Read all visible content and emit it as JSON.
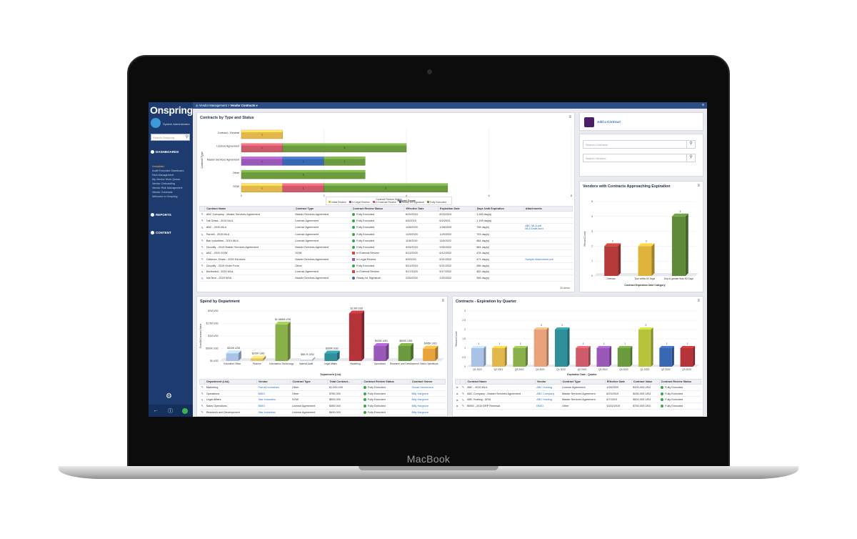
{
  "device": {
    "brand": "MacBook"
  },
  "app": {
    "logo": "Onspring",
    "user": "System Administrator",
    "search_placeholder": "Search Onspring",
    "sections": {
      "dashboards": "DASHBOARDS",
      "reports": "REPORTS",
      "content": "CONTENT"
    },
    "dashboards": [
      "Unbuilded",
      "Audit Executive Dashboard",
      "R&A Management",
      "My Vendor Work Queue",
      "Vendor Onboarding",
      "Vendor Risk Management",
      "Vendor Contracts",
      "Welcome to Onspring"
    ],
    "active_dashboard": 0
  },
  "breadcrumb": {
    "root": "Vendor Management",
    "sep": ">",
    "current": "Vendor Contracts ▾"
  },
  "contracts_panel": {
    "title": "Contracts by Type and Status",
    "legend_title": "Contract Review Status",
    "chart_data": {
      "type": "bar",
      "orientation": "horizontal",
      "stacked": true,
      "categories": [
        "Contract - General",
        "License Agreement",
        "Master Services Agreement",
        "Other",
        "SOW"
      ],
      "series": [
        {
          "name": "Initial Review",
          "color": "#e3b84a",
          "values": [
            1,
            0,
            0,
            0,
            1
          ]
        },
        {
          "name": "In Legal Review",
          "color": "#9a58b8",
          "values": [
            0,
            0,
            1,
            0,
            0
          ]
        },
        {
          "name": "In External Review",
          "color": "#cf5a6a",
          "values": [
            0,
            1,
            0,
            0,
            1
          ]
        },
        {
          "name": "Ready for Signature",
          "color": "#3a67b2",
          "values": [
            0,
            0,
            1,
            0,
            0
          ]
        },
        {
          "name": "Fully Executed",
          "color": "#6c9a3e",
          "values": [
            0,
            3,
            1,
            3,
            3
          ]
        }
      ],
      "xlabel": "Record Count",
      "ylabel": "Contract Type",
      "xlim": [
        0,
        8
      ],
      "ticks": [
        0,
        2,
        4,
        6,
        8
      ]
    },
    "table": {
      "headers": [
        "Contract Name",
        "Contract Type",
        "Contract Review Status",
        "Effective Date",
        "Expiration Date",
        "Days Until Expiration",
        "Attachments"
      ],
      "rows": [
        [
          "ABC Company - Master Services Agreement",
          "Master Services Agreement",
          "Fully Executed",
          "8/20/2019",
          "8/23/2024",
          "1,283 day(s)",
          ""
        ],
        [
          "Tall Grass - 2019 MLA",
          "License Agreement",
          "Fully Executed",
          "6/3/2019",
          "6/2/2024",
          "1,199 day(s)",
          ""
        ],
        [
          "ABC - 2020 MLA",
          "License Agreement",
          "Fully Executed",
          "1/28/2020",
          "1/28/2023",
          "708 day(s)",
          "ABC MLA.pdf\nMLA Draft.docx"
        ],
        [
          "Parnell - 2019 MLA",
          "License Agreement",
          "Fully Executed",
          "1/29/2020",
          "1/29/2022",
          "703 day(s)",
          ""
        ],
        [
          "Bair Industries - 2019 MLA",
          "License Agreement",
          "Fully Executed",
          "11/6/2019",
          "11/6/2022",
          "684 day(s)",
          ""
        ],
        [
          "Cloudify - 2019 Master Services Agreement",
          "Master Services Agreement",
          "Fully Executed",
          "9/26/2019",
          "9/26/2022",
          "584 day(s)",
          ""
        ],
        [
          "ABC - 2020 SOW",
          "SOW",
          "In External Review",
          "6/12/2020",
          "6/12/2022",
          "478 day(s)",
          ""
        ],
        [
          "Callahan, Drake - 2020 Services",
          "Master Services Agreement",
          "In Legal Review",
          "6/3/2020",
          "5/21/2022",
          "471 day(s)",
          "Sample Attachment.pdf"
        ],
        [
          "Cloudify - 2019 Order Form",
          "Other",
          "Fully Executed",
          "5/21/2019",
          "5/21/2022",
          "456 day(s)",
          ""
        ],
        [
          "Northwind - 2020 MLA",
          "License Agreement",
          "In External Review",
          "5/17/2020",
          "5/17/2022",
          "452 day(s)",
          ""
        ],
        [
          "InfoTech - 2020 MSA",
          "Master Services Agreement",
          "Ready for Signature",
          "2/20/2020",
          "2/20/2022",
          "396 day(s)",
          ""
        ]
      ],
      "status_colors": {
        "Fully Executed": "green",
        "In External Review": "red",
        "In Legal Review": "purple",
        "Ready for Signature": "blue"
      },
      "footer": "20 items"
    }
  },
  "side_panel": {
    "add_label": "Add a Contract",
    "search_contracts": "Search Contracts",
    "search_vendors": "Search Vendors"
  },
  "expiring_panel": {
    "title": "Vendors with Contracts Approaching Expiration",
    "chart_data": {
      "type": "bar",
      "categories": [
        "Overdue",
        "Due within 60 Days",
        "Due in greater than 90 Days"
      ],
      "values": [
        2,
        2,
        4
      ],
      "colors": [
        "#b73a3a",
        "#e0b43c",
        "#5f8a3a"
      ],
      "xlabel": "Contract Expiration Date Category",
      "ylabel": "Record Count",
      "ylim": [
        0,
        5
      ],
      "ticks": [
        0,
        1,
        2,
        3,
        4,
        5
      ]
    }
  },
  "spend_panel": {
    "title": "Spend by Department",
    "chart_data": {
      "type": "bar",
      "categories": [
        "Executive Office",
        "Finance",
        "Information Technology",
        "Internal Audit",
        "Legal Affairs",
        "Marketing",
        "Operations",
        "Research and Development",
        "Sales Operations"
      ],
      "values": [
        310000,
        100000,
        1460000,
        58700,
        300000,
        1900000,
        600000,
        600000,
        495000
      ],
      "data_labels": [
        "$310K USD",
        "$100K USD",
        "$1.46MM USD",
        "$58.7K USD",
        "$300K USD",
        "$1.9M USD",
        "$600K USD",
        "$600K USD",
        "$495K USD"
      ],
      "colors": [
        "#a9c2e6",
        "#e3c56a",
        "#8ab04a",
        "#cfd6e2",
        "#2f8f99",
        "#b4343a",
        "#9a58b8",
        "#6c9a3e",
        "#e8a33c"
      ],
      "xlabel": "Department (List)",
      "ylabel": "Sum All Contract Value",
      "ylim": [
        0,
        2000000
      ],
      "ticks": [
        "$0 USD",
        "$500K USD",
        "$1M USD",
        "$1.5M USD",
        "$2M USD"
      ]
    },
    "table": {
      "headers": [
        "Department (List)",
        "Vendor",
        "Contract Type",
        "Total Contract...",
        "Contract Review Status",
        "Contract Owner"
      ],
      "rows": [
        [
          "Marketing",
          "Parnell Industries",
          "Other",
          "$1,000,000",
          "Fully Executed",
          "Susan Henderson"
        ],
        [
          "Operations",
          "BMIO",
          "Other",
          "$750,000",
          "Fully Executed",
          "Billy Hargrove"
        ],
        [
          "Legal Affairs",
          "Star Industries",
          "SOW",
          "$500,000",
          "Fully Executed",
          "Billy Hargrove"
        ],
        [
          "Sales Operations",
          "BMIO",
          "License Agreement",
          "$450,000",
          "Fully Executed",
          "Billy Hargrove"
        ],
        [
          "Research and Development",
          "Star Industries",
          "License Agreement",
          "$400,000",
          "Fully Executed",
          "Billy Hargrove"
        ]
      ]
    }
  },
  "quarter_panel": {
    "title": "Contracts - Expiration by Quarter",
    "chart_data": {
      "type": "bar",
      "categories": [
        "Q1 2021",
        "Q2 2021",
        "Q3 2021",
        "Q4 2021",
        "Q1 2022",
        "Q2 2022",
        "Q3 2022",
        "Q4 2022",
        "Q1 2023",
        "Q2 2023",
        "Q3 2023"
      ],
      "values": [
        1,
        1,
        1,
        2,
        2,
        1,
        1,
        1,
        2,
        1,
        1
      ],
      "colors": [
        "#a9c2e6",
        "#e3b84a",
        "#8ab04a",
        "#e8a37a",
        "#2f8f99",
        "#cf5a6a",
        "#9a58b8",
        "#6c9a3e",
        "#b5c43a",
        "#3a67b2",
        "#b4343a"
      ],
      "xlabel": "Expiration Date - Quarter",
      "ylabel": "Record Count",
      "ylim": [
        0,
        3
      ],
      "ticks": [
        0,
        0.5,
        1,
        1.5,
        2,
        2.5,
        3
      ]
    },
    "table": {
      "headers": [
        "Contract Name",
        "Vendor",
        "Contract Type",
        "Effective Date",
        "Contract Value",
        "Contract Review Status"
      ],
      "rows": [
        [
          "ABC - 2020 MLA",
          "ABC Hosting",
          "License Agreement",
          "1/28/2020",
          "$100,000 USD",
          "Fully Executed"
        ],
        [
          "ABC Company - Master Services Agreement",
          "ABC Company",
          "Master Services Agreement",
          "8/23/2019",
          "$250,000 USD",
          "Fully Executed"
        ],
        [
          "ABC Hosting - MSA",
          "ABC Hosting",
          "Master Services Agreement",
          "6/7/2019",
          "$500,000 USD",
          "Fully Executed"
        ],
        [
          "BMIO - 2019 ERP Renewal",
          "BMIO",
          "Other",
          "10/22/2019",
          "$750,000 USD",
          "Fully Executed"
        ]
      ]
    }
  }
}
